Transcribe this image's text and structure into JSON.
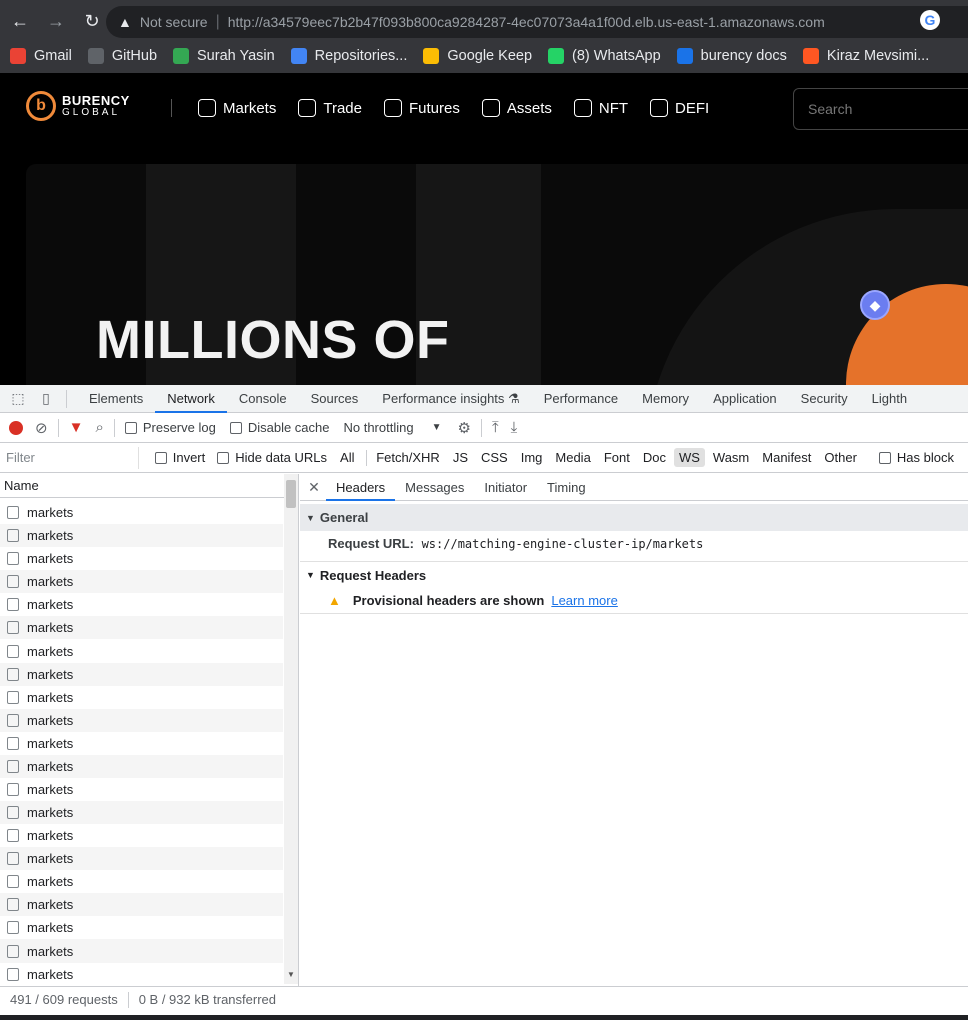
{
  "browser": {
    "security_label": "Not secure",
    "url_host": "http://a34579eec7b2b47f093b800ca9284287-4ec07073a4a1f00d.elb.us-east-1.amazonaws.com",
    "bookmarks": [
      {
        "label": "Gmail",
        "color": "#ea4335"
      },
      {
        "label": "GitHub",
        "color": "#5f6368"
      },
      {
        "label": "Surah Yasin",
        "color": "#34a853"
      },
      {
        "label": "Repositories...",
        "color": "#4285f4"
      },
      {
        "label": "Google Keep",
        "color": "#fbbc04"
      },
      {
        "label": "(8) WhatsApp",
        "color": "#25d366"
      },
      {
        "label": "burency docs",
        "color": "#1a73e8"
      },
      {
        "label": "Kiraz Mevsimi...",
        "color": "#ff5722"
      }
    ]
  },
  "site": {
    "logo_line1": "BURENCY",
    "logo_line2": "GLOBAL",
    "nav": [
      "Markets",
      "Trade",
      "Futures",
      "Assets",
      "NFT",
      "DEFI"
    ],
    "search_placeholder": "Search",
    "hero_title": "MILLIONS OF",
    "accent": "#e5722a"
  },
  "devtools": {
    "tabs": [
      "Elements",
      "Network",
      "Console",
      "Sources",
      "Performance insights ⚗",
      "Performance",
      "Memory",
      "Application",
      "Security",
      "Lighth"
    ],
    "active_tab": "Network",
    "toolbar": {
      "preserve_log": "Preserve log",
      "disable_cache": "Disable cache",
      "throttling": "No throttling"
    },
    "filter": {
      "placeholder": "Filter",
      "invert": "Invert",
      "hide_data_urls": "Hide data URLs",
      "types": [
        "All",
        "Fetch/XHR",
        "JS",
        "CSS",
        "Img",
        "Media",
        "Font",
        "Doc",
        "WS",
        "Wasm",
        "Manifest",
        "Other"
      ],
      "active_type": "WS",
      "has_blocked": "Has block"
    },
    "list_header": "Name",
    "requests": [
      "markets",
      "markets",
      "markets",
      "markets",
      "markets",
      "markets",
      "markets",
      "markets",
      "markets",
      "markets",
      "markets",
      "markets",
      "markets",
      "markets",
      "markets",
      "markets",
      "markets",
      "markets",
      "markets",
      "markets",
      "markets"
    ],
    "status": {
      "requests": "491 / 609 requests",
      "transferred": "0 B / 932 kB transferred"
    },
    "detail": {
      "tabs": [
        "Headers",
        "Messages",
        "Initiator",
        "Timing"
      ],
      "active_tab": "Headers",
      "general_title": "General",
      "request_url_label": "Request URL:",
      "request_url_value": "ws://matching-engine-cluster-ip/markets",
      "request_headers_title": "Request Headers",
      "provisional_text": "Provisional headers are shown",
      "learn_more": "Learn more"
    }
  }
}
